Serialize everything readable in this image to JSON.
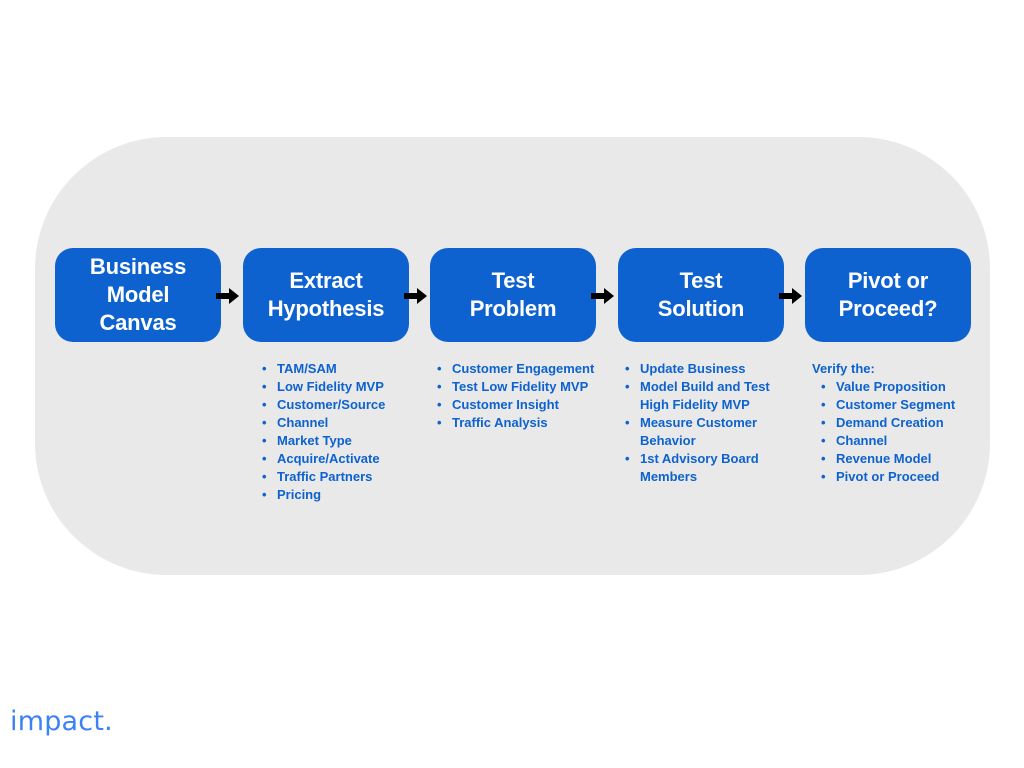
{
  "slide": {
    "background_color": "#ffffff",
    "panel_color": "#e9e9e9",
    "accent_color": "#0d62cf",
    "arrow_color": "#000000",
    "logo_color": "#3b82f6"
  },
  "process": {
    "stages": [
      {
        "label": "Business Model\nCanvas"
      },
      {
        "label": "Extract\nHypothesis"
      },
      {
        "label": "Test\nProblem"
      },
      {
        "label": "Test\nSolution"
      },
      {
        "label": "Pivot or\nProceed?"
      }
    ],
    "arrows": [
      {
        "name": "arrow-1"
      },
      {
        "name": "arrow-2"
      },
      {
        "name": "arrow-3"
      },
      {
        "name": "arrow-4"
      }
    ]
  },
  "columns": [
    {
      "stage": "Business Model Canvas",
      "heading": "",
      "items": []
    },
    {
      "stage": "Extract Hypothesis",
      "heading": "",
      "items": [
        "TAM/SAM",
        "Low Fidelity MVP",
        "Customer/Source",
        "Channel",
        "Market Type",
        "Acquire/Activate",
        "Traffic Partners",
        "Pricing"
      ]
    },
    {
      "stage": "Test Problem",
      "heading": "",
      "items": [
        "Customer Engagement",
        "Test Low Fidelity MVP",
        "Customer Insight",
        "Traffic Analysis"
      ]
    },
    {
      "stage": "Test Solution",
      "heading": "",
      "items": [
        "Update Business",
        "Model Build and Test High Fidelity MVP",
        "Measure Customer Behavior",
        "1st Advisory Board Members"
      ]
    },
    {
      "stage": "Pivot or Proceed?",
      "heading": "Verify the:",
      "items": [
        "Value Proposition",
        "Customer Segment",
        "Demand Creation",
        "Channel",
        "Revenue Model",
        "Pivot or Proceed"
      ]
    }
  ],
  "logo": {
    "text": "impact."
  }
}
